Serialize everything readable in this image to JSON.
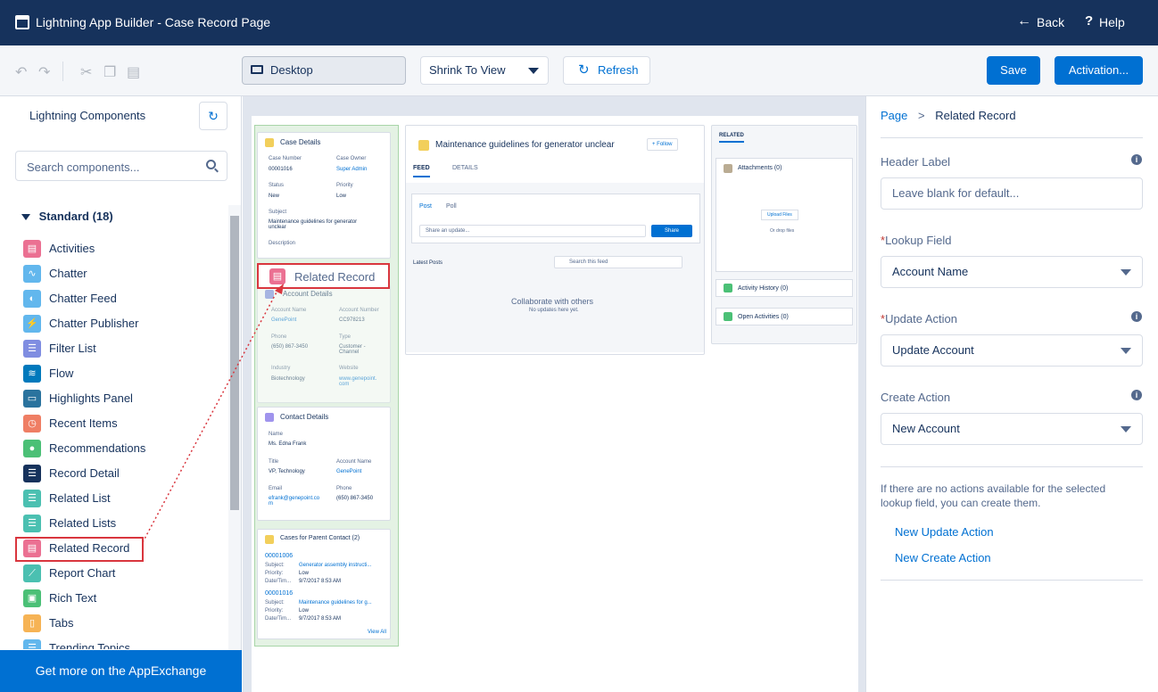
{
  "app": {
    "title": "Lightning App Builder - Case Record Page",
    "back": "Back",
    "help": "Help"
  },
  "toolbar": {
    "device": "Desktop",
    "zoom": "Shrink To View",
    "refresh": "Refresh",
    "save": "Save",
    "activation": "Activation..."
  },
  "left": {
    "header": "Lightning Components",
    "search_placeholder": "Search components...",
    "section": "Standard (18)",
    "footer": "Get more on the AppExchange",
    "items": [
      {
        "label": "Activities",
        "icon": "activities-icon",
        "color": "#eb7092"
      },
      {
        "label": "Chatter",
        "icon": "chatter-icon",
        "color": "#62b7ed"
      },
      {
        "label": "Chatter Feed",
        "icon": "chatter-feed-icon",
        "color": "#62b7ed"
      },
      {
        "label": "Chatter Publisher",
        "icon": "chatter-publisher-icon",
        "color": "#62b7ed"
      },
      {
        "label": "Filter List",
        "icon": "filter-list-icon",
        "color": "#7f8de1"
      },
      {
        "label": "Flow",
        "icon": "flow-icon",
        "color": "#0079bc"
      },
      {
        "label": "Highlights Panel",
        "icon": "highlights-panel-icon",
        "color": "#2a739e"
      },
      {
        "label": "Recent Items",
        "icon": "recent-items-icon",
        "color": "#ef7e64"
      },
      {
        "label": "Recommendations",
        "icon": "recommendations-icon",
        "color": "#4bc076"
      },
      {
        "label": "Record Detail",
        "icon": "record-detail-icon",
        "color": "#16325c"
      },
      {
        "label": "Related List",
        "icon": "related-list-icon",
        "color": "#4bc0b1"
      },
      {
        "label": "Related Lists",
        "icon": "related-lists-icon",
        "color": "#4bc0b1"
      },
      {
        "label": "Related Record",
        "icon": "related-record-icon",
        "color": "#eb7092"
      },
      {
        "label": "Report Chart",
        "icon": "report-chart-icon",
        "color": "#4bc0b1"
      },
      {
        "label": "Rich Text",
        "icon": "rich-text-icon",
        "color": "#4bc076"
      },
      {
        "label": "Tabs",
        "icon": "tabs-icon",
        "color": "#f6b355"
      },
      {
        "label": "Trending Topics",
        "icon": "trending-topics-icon",
        "color": "#62b7ed"
      }
    ]
  },
  "canvas": {
    "drag_label": "Related Record",
    "case_details": {
      "title": "Case Details",
      "f1l": "Case Number",
      "f1v": "00001016",
      "f2l": "Case Owner",
      "f2v": "Super Admin",
      "f3l": "Status",
      "f3v": "New",
      "f4l": "Priority",
      "f4v": "Low",
      "f5l": "Subject",
      "f5v": "Maintenance guidelines for generator unclear",
      "f6l": "Description"
    },
    "account_details": {
      "title": "Account Details",
      "f1l": "Account Name",
      "f1v": "GenePoint",
      "f2l": "Account Number",
      "f2v": "CC978213",
      "f3l": "Phone",
      "f3v": "(650) 867-3450",
      "f4l": "Type",
      "f4v": "Customer - Channel",
      "f5l": "Industry",
      "f5v": "Biotechnology",
      "f6l": "Website",
      "f6v": "www.genepoint.com"
    },
    "contact_details": {
      "title": "Contact Details",
      "f1l": "Name",
      "f1v": "Ms. Edna Frank",
      "f2l": "Title",
      "f2v": "VP, Technology",
      "f3l": "Account Name",
      "f3v": "GenePoint",
      "f4l": "Email",
      "f4v": "efrank@genepoint.com",
      "f5l": "Phone",
      "f5v": "(650) 867-3450"
    },
    "cases": {
      "title": "Cases for Parent Contact (2)",
      "c1": "00001006",
      "c1s": "Generator assembly instructi...",
      "c1p": "Low",
      "c1d": "9/7/2017 8:53 AM",
      "c2": "00001016",
      "c2s": "Maintenance guidelines for g...",
      "c2p": "Low",
      "c2d": "9/7/2017 8:53 AM",
      "subject": "Subject:",
      "priority": "Priority:",
      "date": "Date/Tim...",
      "viewall": "View All"
    },
    "feed": {
      "title": "Maintenance guidelines for generator unclear",
      "follow": "+ Follow",
      "tab1": "FEED",
      "tab2": "DETAILS",
      "post": "Post",
      "poll": "Poll",
      "share_ph": "Share an update...",
      "share": "Share",
      "latest": "Latest Posts",
      "search": "Search this feed",
      "collab": "Collaborate with others",
      "noupd": "No updates here yet."
    },
    "related": {
      "tab": "RELATED",
      "attach": "Attachments (0)",
      "upload": "Upload Files",
      "drop": "Or drop files",
      "activity": "Activity History (0)",
      "open": "Open Activities (0)"
    }
  },
  "right": {
    "crumb_page": "Page",
    "crumb_sep": ">",
    "crumb_current": "Related Record",
    "header_label": "Header Label",
    "header_placeholder": "Leave blank for default...",
    "lookup_label": "Lookup Field",
    "lookup_value": "Account Name",
    "update_label": "Update Action",
    "update_value": "Update Account",
    "create_label": "Create Action",
    "create_value": "New Account",
    "help_text": "If there are no actions available for the selected lookup field, you can create them.",
    "new_update": "New Update Action",
    "new_create": "New Create Action"
  }
}
